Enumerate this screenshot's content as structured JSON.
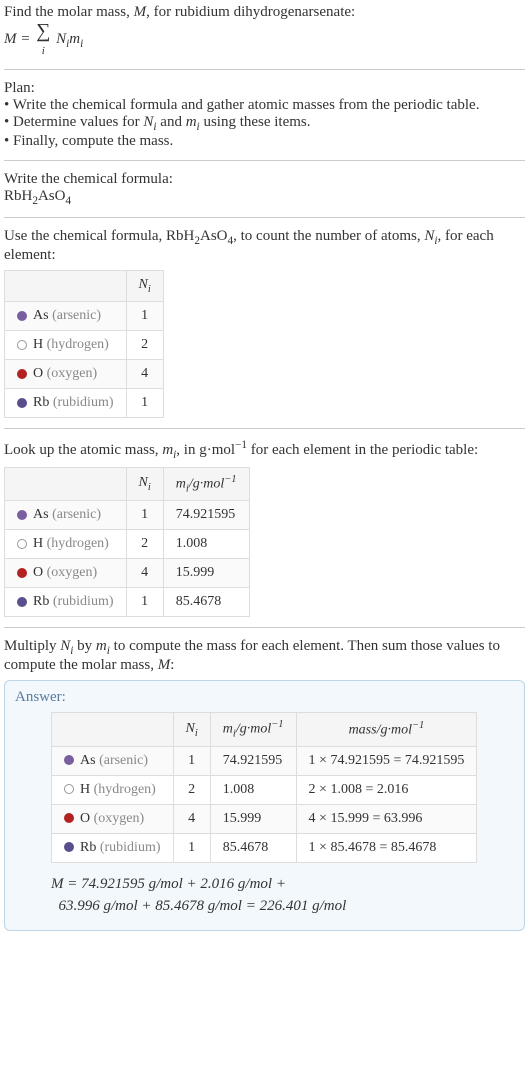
{
  "intro": {
    "line1": "Find the molar mass, ",
    "line1b": ", for rubidium dihydrogenarsenate:",
    "formula_prefix": "M = ",
    "formula_suffix": " N",
    "formula_suffix2": "m"
  },
  "plan": {
    "header": "Plan:",
    "b1": "• Write the chemical formula and gather atomic masses from the periodic table.",
    "b2_prefix": "• Determine values for ",
    "b2_mid": " and ",
    "b2_suffix": " using these items.",
    "b3": "• Finally, compute the mass."
  },
  "writeFormula": {
    "header": "Write the chemical formula:",
    "formula": "RbH",
    "formula2": "AsO"
  },
  "count": {
    "prefix": "Use the chemical formula, RbH",
    "mid": "AsO",
    "suffix": ", to count the number of atoms, ",
    "suffix2": ", for each element:"
  },
  "headers": {
    "Ni": "N",
    "mi": "m",
    "massHeader": "mass/g·mol",
    "miUnit": "/g·mol"
  },
  "elements": [
    {
      "color": "#7a5fa0",
      "border": "#7a5fa0",
      "sym": "As",
      "name": "(arsenic)",
      "N": "1",
      "m": "74.921595",
      "mass": "1 × 74.921595 = 74.921595"
    },
    {
      "color": "#ffffff",
      "border": "#999",
      "sym": "H",
      "name": "(hydrogen)",
      "N": "2",
      "m": "1.008",
      "mass": "2 × 1.008 = 2.016"
    },
    {
      "color": "#b22222",
      "border": "#b22222",
      "sym": "O",
      "name": "(oxygen)",
      "N": "4",
      "m": "15.999",
      "mass": "4 × 15.999 = 63.996"
    },
    {
      "color": "#5b4e8c",
      "border": "#5b4e8c",
      "sym": "Rb",
      "name": "(rubidium)",
      "N": "1",
      "m": "85.4678",
      "mass": "1 × 85.4678 = 85.4678"
    }
  ],
  "lookup": {
    "prefix": "Look up the atomic mass, ",
    "mid": ", in g·mol",
    "suffix": " for each element in the periodic table:"
  },
  "multiply": {
    "prefix": "Multiply ",
    "mid1": " by ",
    "mid2": " to compute the mass for each element. Then sum those values to compute the molar mass, ",
    "suffix": ":"
  },
  "answer": {
    "label": "Answer:",
    "final1": "M = 74.921595 g/mol + 2.016 g/mol + ",
    "final2": "63.996 g/mol + 85.4678 g/mol = 226.401 g/mol"
  },
  "sym": {
    "M": "M",
    "Ni": "N",
    "mi": "m",
    "i": "i",
    "sigma": "∑",
    "neg1": "−1",
    "two": "2",
    "four": "4"
  }
}
